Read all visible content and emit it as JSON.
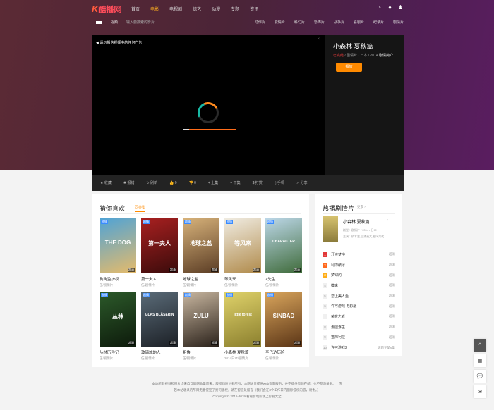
{
  "logo": {
    "k": "K",
    "text": "酷播网"
  },
  "nav": {
    "items": [
      "首页",
      "电影",
      "电视剧",
      "综艺",
      "动漫",
      "专题",
      "资讯"
    ],
    "active_index": 1
  },
  "subbar": {
    "search_select": "视频",
    "search_placeholder": "输入要搜索的影片",
    "categories": [
      "动作片",
      "爱情片",
      "科幻片",
      "恐怖片",
      "战争片",
      "喜剧片",
      "纪录片",
      "剧情片"
    ]
  },
  "player": {
    "ad_text": "◀ 请勿相信视频中的任何广告",
    "close": "×"
  },
  "info": {
    "title": "小森林 夏秋篇",
    "meta_red": "已完结",
    "meta_mid": " / 剧情片 / 日本 / 2014 ",
    "meta_white": "剧情简介",
    "button": "播放"
  },
  "controls": [
    "收藏",
    "报错",
    "刷新",
    "0",
    "0",
    "上集",
    "下集",
    "打赏",
    "手机",
    "分享"
  ],
  "likes": {
    "heading": "猜你喜欢",
    "tab": "同类型",
    "movies": [
      {
        "title": "狗狗监护权",
        "sub": "伍/剧情片",
        "tag": "剧情",
        "corner": "超清",
        "poster": "THE DOG",
        "c1": "#4fa3d6",
        "c2": "#e6bb6a"
      },
      {
        "title": "第一夫人",
        "sub": "伍/剧情片",
        "tag": "剧情",
        "corner": "超清",
        "poster": "第一夫人",
        "c1": "#a82020",
        "c2": "#3a0b0b"
      },
      {
        "title": "地球之盐",
        "sub": "伍/剧情片",
        "tag": "剧情",
        "corner": "超清",
        "poster": "地球之盐",
        "c1": "#d7b27a",
        "c2": "#5a3c24"
      },
      {
        "title": "等风来",
        "sub": "伍/剧情片",
        "tag": "剧情",
        "corner": "超清",
        "poster": "等风来",
        "c1": "#f0ece2",
        "c2": "#b08a4a"
      },
      {
        "title": "Z先生",
        "sub": "伍/剧情片",
        "tag": "剧情",
        "corner": "超清",
        "poster": "CHARACTER",
        "c1": "#bcd7e8",
        "c2": "#3f6b3a"
      },
      {
        "title": "丛林历险记",
        "sub": "伍/剧情片",
        "tag": "剧情",
        "corner": "超清",
        "poster": "丛林",
        "c1": "#2c5a2a",
        "c2": "#0d1a0b"
      },
      {
        "title": "玻璃城的人",
        "sub": "伍/剧情片",
        "tag": "剧情",
        "corner": "超清",
        "poster": "GLAS BLÄSERIN",
        "c1": "#5a6b78",
        "c2": "#1c2026"
      },
      {
        "title": "祖鲁",
        "sub": "伍/剧情片",
        "tag": "剧情",
        "corner": "超清",
        "poster": "ZULU",
        "c1": "#c9b7a0",
        "c2": "#2a211a"
      },
      {
        "title": "小森林 夏秋篇",
        "sub": "2014日本/剧情片",
        "tag": "剧情",
        "corner": "超清",
        "poster": "little forest",
        "c1": "#dfd26a",
        "c2": "#8b7f2e"
      },
      {
        "title": "辛巴达历险",
        "sub": "伍/剧情片",
        "tag": "剧情",
        "corner": "超清",
        "poster": "SINBAD",
        "c1": "#d9a55c",
        "c2": "#5b3516"
      }
    ]
  },
  "hot": {
    "heading": "热播剧情片",
    "more": "更多 ›",
    "feature": {
      "title": "小森林 夏秋篇",
      "arrow": "›",
      "meta": "剧型：剧情片 / 2014 / 日本",
      "desc": "主演：桥本爱,三浦贵大,松冈茉优..."
    },
    "list": [
      {
        "num": "1",
        "name": "汗液梦序",
        "ep": "超清"
      },
      {
        "num": "2",
        "name": "利刃破冰",
        "ep": "超清"
      },
      {
        "num": "3",
        "name": "梦幻的",
        "ep": "超清"
      },
      {
        "num": "4",
        "name": "摸鬼",
        "ep": "超清"
      },
      {
        "num": "5",
        "name": "恋上美人鱼",
        "ep": "超清"
      },
      {
        "num": "6",
        "name": "许可游戏 电影版",
        "ep": "超清"
      },
      {
        "num": "7",
        "name": "荣誉之者",
        "ep": "超清"
      },
      {
        "num": "8",
        "name": "潮湿浮生",
        "ep": "超清"
      },
      {
        "num": "9",
        "name": "猫咪柯拉",
        "ep": "超清"
      },
      {
        "num": "10",
        "name": "许可游戏2",
        "ep": "更新至第6集"
      }
    ]
  },
  "footer": {
    "line1": "本站所有视频和图片均来自互联网收集而来，版权归原创者所有，本网站只提供web页面服务，并不提供资源存储，也不参与录制、上传",
    "line2": "若本站收录的节目无意侵犯了贵司版权，请在留言处留言（我们会在3个工作日内删除侵权内容，谢谢。）",
    "line3": "Copyright © 2015-2019 看看影电影线上影视大全"
  },
  "side_buttons": [
    "^",
    "▦",
    "💬",
    "✉"
  ]
}
